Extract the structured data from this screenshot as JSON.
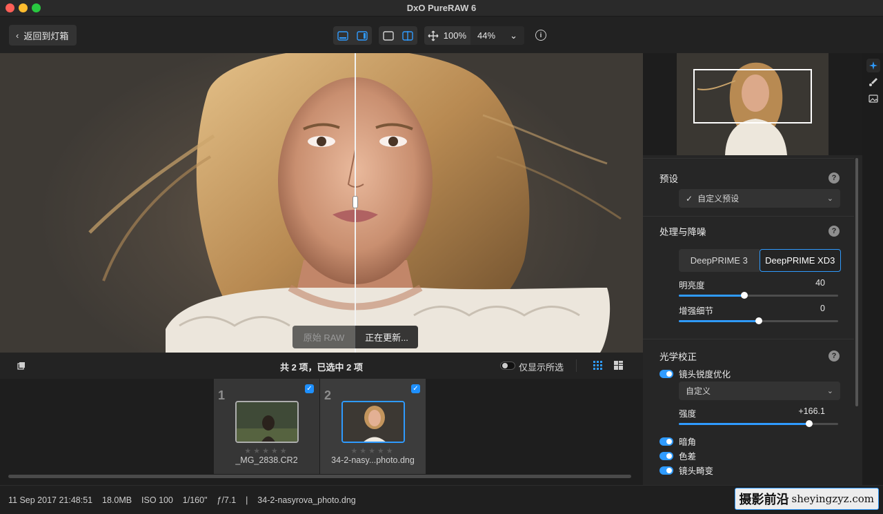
{
  "window": {
    "title": "DxO PureRAW 6"
  },
  "toolbar": {
    "back_label": "返回到灯箱",
    "zoom_fixed": "100%",
    "zoom_select": "44%"
  },
  "viewer": {
    "compare_original": "原始 RAW",
    "compare_processed": "正在更新..."
  },
  "strip": {
    "count_text": "共 2 项，已选中 2 项",
    "only_selected": "仅显示所选",
    "items": [
      {
        "index": "1",
        "name": "_MG_2838.CR2",
        "stars": "★★★★★",
        "checked": true
      },
      {
        "index": "2",
        "name": "34-2-nasy...photo.dng",
        "stars": "★★★★★",
        "checked": true
      }
    ]
  },
  "status": {
    "date": "11 Sep 2017 21:48:51",
    "size": "18.0MB",
    "iso": "ISO 100",
    "shutter": "1/160\"",
    "aperture": "ƒ/7.1",
    "separator": "|",
    "filename": "34-2-nasyrova_photo.dng"
  },
  "panel": {
    "preset": {
      "title": "预设",
      "value": "自定义预设"
    },
    "denoise": {
      "title": "处理与降噪",
      "modes": [
        "DeepPRIME 3",
        "DeepPRIME XD3"
      ],
      "active_mode": "DeepPRIME XD3",
      "sliders": [
        {
          "label": "明亮度",
          "value": "40",
          "fraction": 0.41
        },
        {
          "label": "增强细节",
          "value": "0",
          "fraction": 0.5
        }
      ]
    },
    "optics": {
      "title": "光学校正",
      "sharpness_toggle": "镜头锐度优化",
      "sharpness_preset": "自定义",
      "intensity_label": "强度",
      "intensity_value": "+166.1",
      "intensity_fraction": 0.82,
      "toggles": [
        "暗角",
        "色差",
        "镜头畸变"
      ]
    }
  },
  "watermark": {
    "cn": "摄影前沿",
    "url": "sheyingzyz.com"
  },
  "colors": {
    "accent": "#2f9bff",
    "panel_bg": "#262626",
    "toolbar_bg": "#222222"
  }
}
